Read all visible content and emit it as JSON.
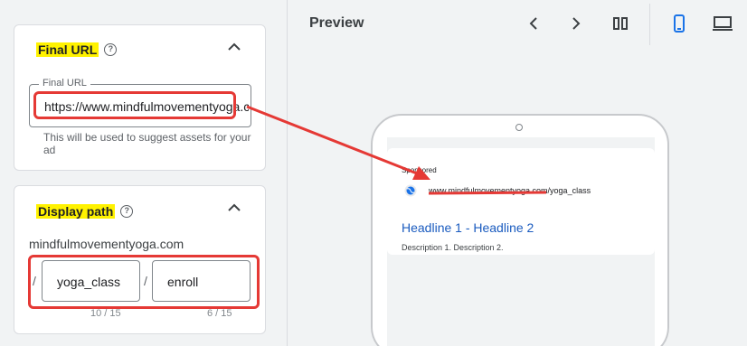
{
  "final_url_card": {
    "title": "Final URL",
    "field_label": "Final URL",
    "field_value": "https://www.mindfulmovementyoga.com",
    "hint": "This will be used to suggest assets for your ad"
  },
  "display_path_card": {
    "title": "Display path",
    "domain": "mindfulmovementyoga.com",
    "separator": "/",
    "path1": "yoga_class",
    "path2": "enroll",
    "path1_counter": "10 / 15",
    "path2_counter": "6 / 15"
  },
  "preview": {
    "title": "Preview",
    "tools": [
      "chevron-left-icon",
      "chevron-right-icon",
      "split-view-icon",
      "mobile-icon",
      "desktop-icon"
    ],
    "ad": {
      "sponsored": "Sponsored",
      "url": "www.mindfulmovementyoga.com/yoga_class",
      "headline": "Headline 1 - Headline 2",
      "description": "Description 1. Description 2."
    }
  },
  "colors": {
    "annotation_red": "#e53935",
    "highlight_yellow": "#fff200",
    "link_blue": "#1a5bbf",
    "active_blue": "#1a73e8"
  }
}
